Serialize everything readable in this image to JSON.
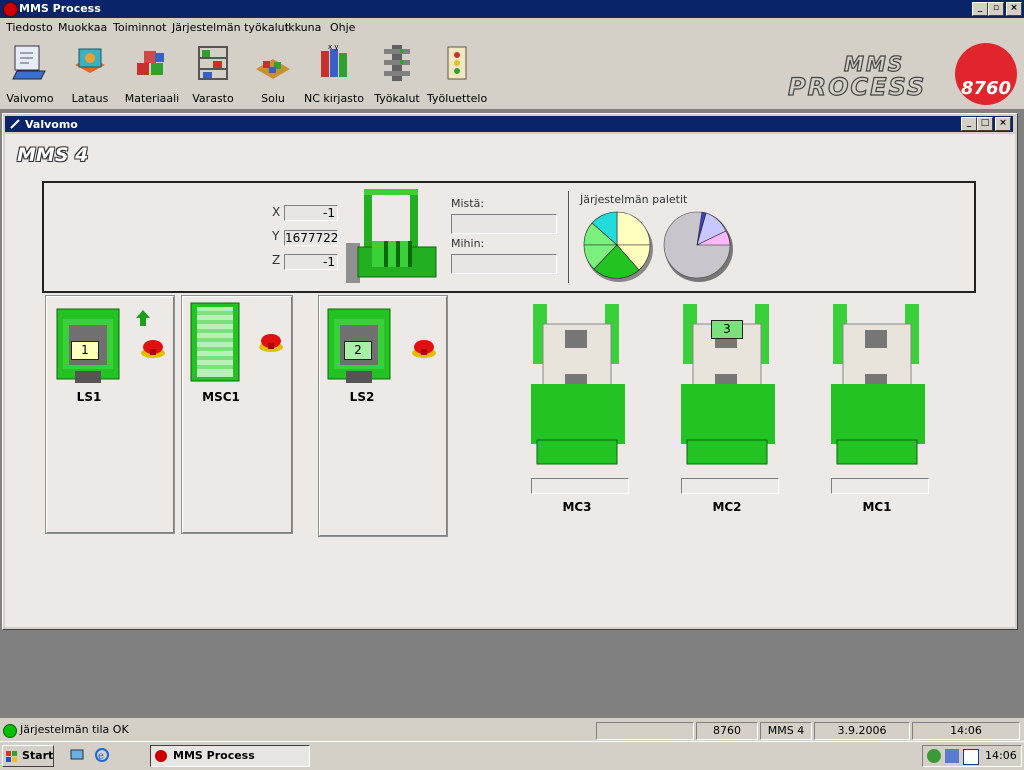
{
  "window": {
    "title": "MMS Process"
  },
  "menu": [
    "Tiedosto",
    "Muokkaa",
    "Toiminnot",
    "Järjestelmän työkalut",
    "Ikkuna",
    "Ohje"
  ],
  "toolbar": [
    {
      "label": "Valvomo",
      "icon": "monitor-icon"
    },
    {
      "label": "Lataus",
      "icon": "loading-icon"
    },
    {
      "label": "Materiaali",
      "icon": "material-icon"
    },
    {
      "label": "Varasto",
      "icon": "storage-icon"
    },
    {
      "label": "Solu",
      "icon": "cell-icon"
    },
    {
      "label": "NC kirjasto",
      "icon": "nc-library-icon"
    },
    {
      "label": "Työkalut",
      "icon": "tools-icon"
    },
    {
      "label": "Työluettelo",
      "icon": "worklist-icon"
    }
  ],
  "brand": {
    "logo_text": "MMS PROCESS",
    "badge": "8760"
  },
  "child_window": {
    "title": "Valvomo"
  },
  "system_name": "MMS 4",
  "crane": {
    "x_label": "X",
    "x_value": "-1",
    "y_label": "Y",
    "y_value": "1677722",
    "z_label": "Z",
    "z_value": "-1",
    "from_label": "Mistä:",
    "from_value": "",
    "to_label": "Mihin:",
    "to_value": ""
  },
  "pallets_label": "Järjestelmän paletit",
  "stations": [
    {
      "name": "LS1",
      "pallet": "1",
      "pallet_color": "#ffffc0"
    },
    {
      "name": "MSC1"
    },
    {
      "name": "LS2",
      "pallet": "2",
      "pallet_color": "#a8f0a8"
    }
  ],
  "machines": [
    {
      "name": "MC3",
      "pallet": "",
      "status": ""
    },
    {
      "name": "MC2",
      "pallet": "3",
      "status": ""
    },
    {
      "name": "MC1",
      "pallet": "",
      "status": ""
    }
  ],
  "statusbar": {
    "state": "Järjestelmän tila OK",
    "code": "8760",
    "system": "MMS 4",
    "date": "3.9.2006",
    "time": "14:06"
  },
  "taskbar": {
    "start": "Start",
    "app": "MMS Process",
    "clock": "14:06"
  },
  "colors": {
    "title_bar": "#0a246a",
    "machine_green": "#22c322",
    "status_ok": "#00c000"
  }
}
